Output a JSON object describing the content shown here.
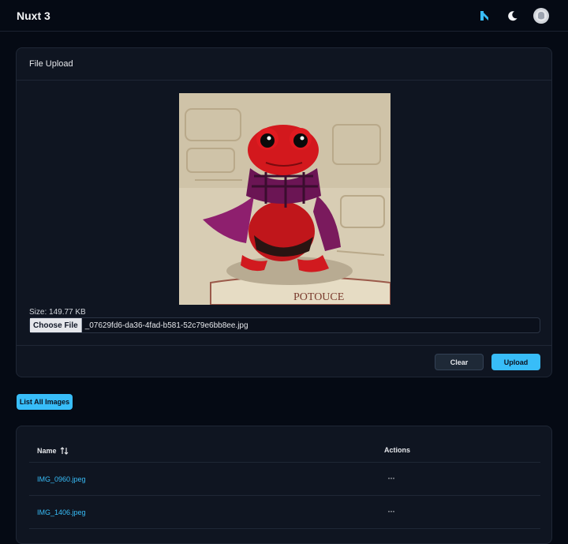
{
  "header": {
    "brand": "Nuxt 3",
    "icons": [
      "nuxt-icon",
      "moon-icon",
      "github-avatar-icon"
    ]
  },
  "upload_card": {
    "title": "File Upload",
    "size_text": "Size: 149.77 KB",
    "choose_file_label": "Choose File",
    "file_name": "_07629fd6-da36-4fad-b581-52c79e6bb8ee.jpg",
    "clear_label": "Clear",
    "upload_label": "Upload"
  },
  "list_button_label": "List All Images",
  "table": {
    "columns": [
      "Name",
      "Actions"
    ],
    "rows": [
      {
        "name": "IMG_0960.jpeg",
        "actions": "···"
      },
      {
        "name": "IMG_1406.jpeg",
        "actions": "···"
      }
    ]
  },
  "colors": {
    "background": "#050a14",
    "card": "#0f1521",
    "accent": "#38bdf8"
  }
}
